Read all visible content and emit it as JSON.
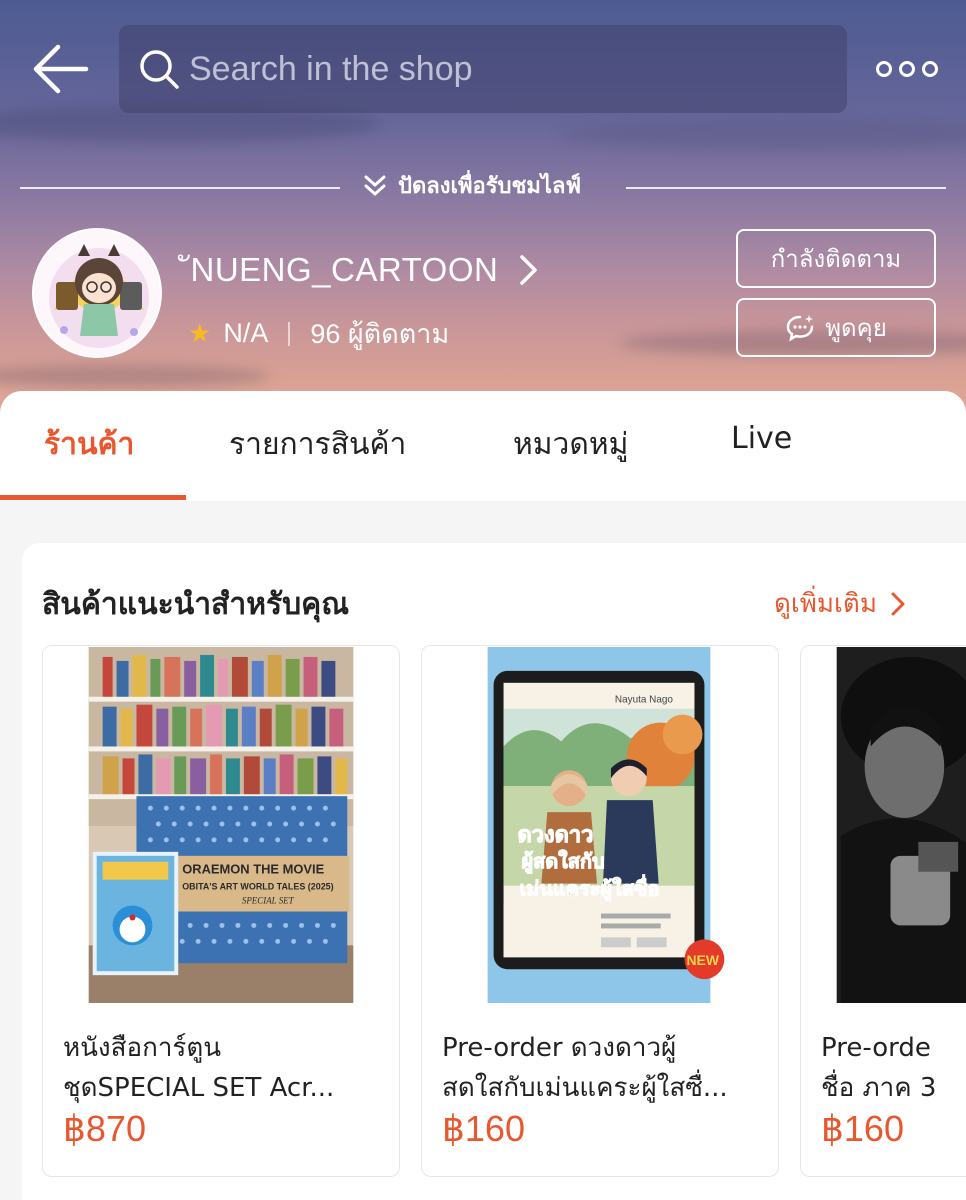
{
  "header": {
    "search_placeholder": "Search in the shop",
    "live_hint": "ปัดลงเพื่อรับชมไลฟ์"
  },
  "shop": {
    "name": "ัNUENG_CARTOON",
    "rating": "N/A",
    "followers": "96 ผู้ติดตาม",
    "follow_label": "กำลังติดตาม",
    "chat_label": "พูดคุย"
  },
  "tabs": [
    {
      "label": "ร้านค้า",
      "active": true
    },
    {
      "label": "รายการสินค้า",
      "active": false
    },
    {
      "label": "หมวดหมู่",
      "active": false
    },
    {
      "label": "Live",
      "active": false
    }
  ],
  "recommended": {
    "title": "สินค้าแนะนำสำหรับคุณ",
    "see_more": "ดูเพิ่มเติม",
    "products": [
      {
        "title_line1": "หนังสือการ์ตูน",
        "title_line2": "ชุดSPECIAL SET Acr...",
        "price": "฿870"
      },
      {
        "title_line1": "Pre-order  ดวงดาวผู้",
        "title_line2": "สดใสกับเม่นแคระผู้ใสซื่...",
        "price": "฿160"
      },
      {
        "title_line1": "Pre-orde",
        "title_line2": "ชื่อ ภาค 3",
        "price": "฿160"
      }
    ]
  },
  "thumb_text": {
    "doraemon_box_line1": "ORAEMON THE MOVIE",
    "doraemon_box_line2": "OBITA'S ART WORLD TALES (2025)",
    "doraemon_box_line3": "SPECIAL SET",
    "novel_author": "Nayuta Nago",
    "novel_title1": "ดวงดาว",
    "novel_title2": "ผู้สดใสกับ",
    "novel_title3": "เม่นแคระผู้ใสซื่อ",
    "new_badge": "NEW"
  },
  "colors": {
    "accent": "#e8572e",
    "star": "#f7b924"
  },
  "icons": [
    "back-arrow-icon",
    "search-icon",
    "more-icon",
    "double-chevron-down-icon",
    "chevron-right-icon",
    "star-icon",
    "chat-bubble-icon"
  ]
}
